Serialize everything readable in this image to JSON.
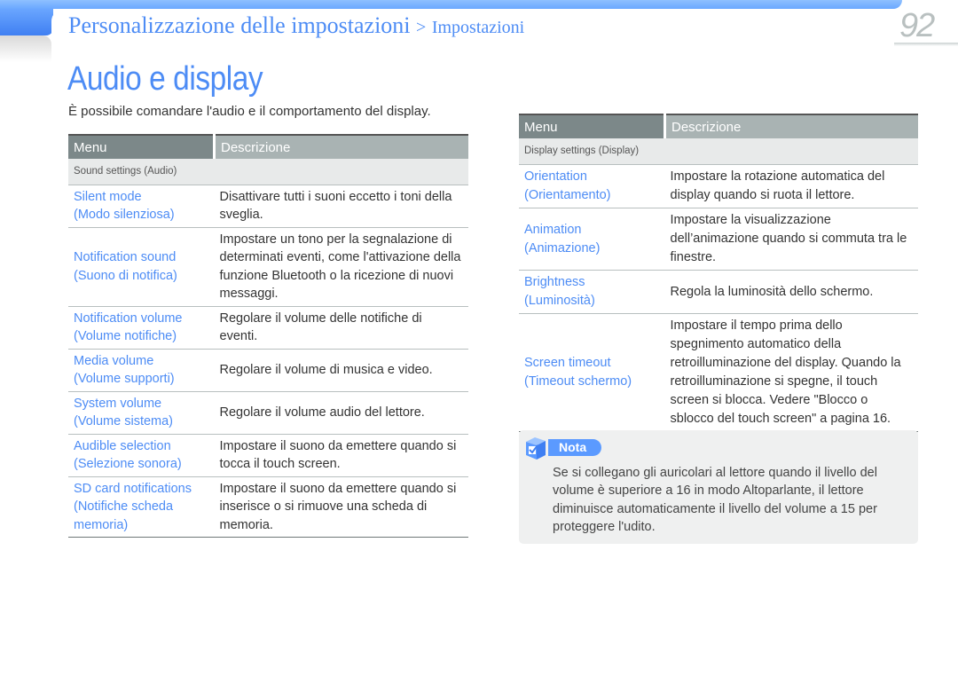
{
  "header": {
    "breadcrumb_main": "Personalizzazione delle impostazioni",
    "breadcrumb_separator": ">",
    "breadcrumb_sub": "Impostazioni",
    "page_number": "92"
  },
  "page": {
    "title": "Audio e display",
    "intro": "È possibile comandare l'audio e il comportamento del display.",
    "accent_color": "#4d8cf5"
  },
  "sound_table": {
    "headers": [
      "Menu",
      "Descrizione"
    ],
    "section": "Sound settings (Audio)",
    "rows": [
      {
        "menu": "Silent mode",
        "menu_it": "(Modo silenziosa)",
        "desc": "Disattivare tutti i suoni eccetto i toni della sveglia."
      },
      {
        "menu": "Notification sound",
        "menu_it": "(Suono di notifica)",
        "desc": "Impostare un tono per la segnalazione di determinati eventi, come l'attivazione della funzione Bluetooth o la ricezione di nuovi messaggi."
      },
      {
        "menu": "Notification volume",
        "menu_it": "(Volume notifiche)",
        "desc": "Regolare il volume delle notifiche di eventi."
      },
      {
        "menu": "Media volume",
        "menu_it": "(Volume supporti)",
        "desc": "Regolare il volume di musica e video."
      },
      {
        "menu": "System volume",
        "menu_it": "(Volume sistema)",
        "desc": "Regolare il volume audio del lettore."
      },
      {
        "menu": "Audible selection",
        "menu_it": "(Selezione sonora)",
        "desc": "Impostare il suono da emettere quando si tocca il touch screen."
      },
      {
        "menu": "SD card notifications",
        "menu_it": "(Notifiche scheda memoria)",
        "desc": "Impostare il suono da emettere quando si inserisce o si rimuove una scheda di memoria."
      }
    ]
  },
  "display_table": {
    "headers": [
      "Menu",
      "Descrizione"
    ],
    "section": "Display settings (Display)",
    "rows": [
      {
        "menu": "Orientation",
        "menu_it": "(Orientamento)",
        "desc": "Impostare la rotazione automatica del display quando si ruota il lettore."
      },
      {
        "menu": "Animation",
        "menu_it": "(Animazione)",
        "desc": "Impostare la visualizzazione dell’animazione quando si commuta tra le finestre."
      },
      {
        "menu": "Brightness",
        "menu_it": "(Luminosità)",
        "desc": "Regola la luminosità dello schermo."
      },
      {
        "menu": "Screen timeout",
        "menu_it": "(Timeout schermo)",
        "desc": "Impostare il tempo prima dello spegnimento automatico della retroilluminazione del display. Quando la retroilluminazione si spegne, il touch screen si blocca. Vedere \"Blocco o sblocco del touch screen\" a pagina 16."
      }
    ]
  },
  "note": {
    "label": "Nota",
    "icon": "checkbox-cube-icon",
    "text": "Se si collegano gli auricolari al lettore quando il livello del volume è superiore a 16 in modo Altoparlante, il lettore diminuisce automaticamente il livello del volume a 15 per proteggere l'udito."
  }
}
